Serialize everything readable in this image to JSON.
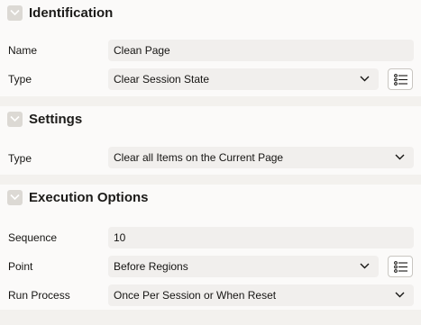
{
  "sections": [
    {
      "title": "Identification",
      "name_label": "Name",
      "name_value": "Clean Page",
      "type_label": "Type",
      "type_value": "Clear Session State"
    },
    {
      "title": "Settings",
      "type_label": "Type",
      "type_value": "Clear all Items on the Current Page"
    },
    {
      "title": "Execution Options",
      "sequence_label": "Sequence",
      "sequence_value": "10",
      "point_label": "Point",
      "point_value": "Before Regions",
      "run_label": "Run Process",
      "run_value": "Once Per Session or When Reset"
    }
  ],
  "icons": {
    "collapse": "chevron-down-icon",
    "select": "chevron-down-icon",
    "list": "list-select-icon"
  },
  "colors": {
    "background": "#f3f1ee",
    "section_background": "#fbfaf9",
    "field_background": "#f1efed",
    "toggle_background": "#dcd9d4"
  }
}
